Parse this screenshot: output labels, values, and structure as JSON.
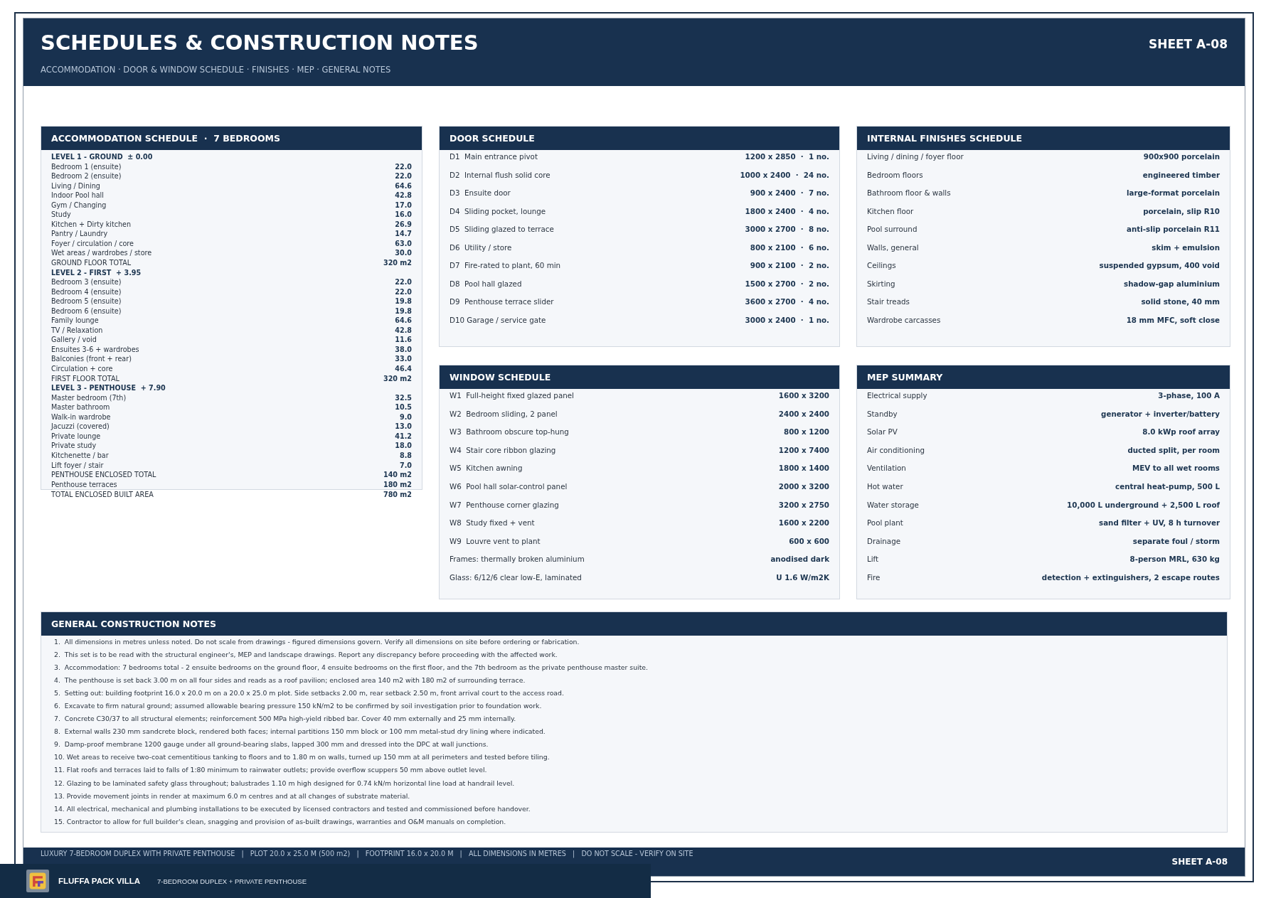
{
  "header": {
    "title": "SCHEDULES & CONSTRUCTION NOTES",
    "subtitle": "ACCOMMODATION · DOOR & WINDOW SCHEDULE · FINISHES · MEP · GENERAL NOTES",
    "sheet": "SHEET A-08"
  },
  "accommodation": {
    "title": "ACCOMMODATION SCHEDULE  ·  7 BEDROOMS",
    "rows": [
      {
        "kind": "level",
        "label": "LEVEL 1 - GROUND  ± 0.00"
      },
      {
        "kind": "room",
        "label": "Bedroom 1 (ensuite)",
        "area": "22.0"
      },
      {
        "kind": "room",
        "label": "Bedroom 2 (ensuite)",
        "area": "22.0"
      },
      {
        "kind": "room",
        "label": "Living / Dining",
        "area": "64.6"
      },
      {
        "kind": "room",
        "label": "Indoor Pool hall",
        "area": "42.8"
      },
      {
        "kind": "room",
        "label": "Gym / Changing",
        "area": "17.0"
      },
      {
        "kind": "room",
        "label": "Study",
        "area": "16.0"
      },
      {
        "kind": "room",
        "label": "Kitchen + Dirty kitchen",
        "area": "26.9"
      },
      {
        "kind": "room",
        "label": "Pantry / Laundry",
        "area": "14.7"
      },
      {
        "kind": "room",
        "label": "Foyer / circulation / core",
        "area": "63.0"
      },
      {
        "kind": "room",
        "label": "Wet areas / wardrobes / store",
        "area": "30.0"
      },
      {
        "kind": "total",
        "label": "GROUND FLOOR TOTAL",
        "area": "320 m2"
      },
      {
        "kind": "level",
        "label": "LEVEL 2 - FIRST  + 3.95"
      },
      {
        "kind": "room",
        "label": "Bedroom 3 (ensuite)",
        "area": "22.0"
      },
      {
        "kind": "room",
        "label": "Bedroom 4 (ensuite)",
        "area": "22.0"
      },
      {
        "kind": "room",
        "label": "Bedroom 5 (ensuite)",
        "area": "19.8"
      },
      {
        "kind": "room",
        "label": "Bedroom 6 (ensuite)",
        "area": "19.8"
      },
      {
        "kind": "room",
        "label": "Family lounge",
        "area": "64.6"
      },
      {
        "kind": "room",
        "label": "TV / Relaxation",
        "area": "42.8"
      },
      {
        "kind": "room",
        "label": "Gallery / void",
        "area": "11.6"
      },
      {
        "kind": "room",
        "label": "Ensuites 3-6 + wardrobes",
        "area": "38.0"
      },
      {
        "kind": "room",
        "label": "Balconies (front + rear)",
        "area": "33.0"
      },
      {
        "kind": "room",
        "label": "Circulation + core",
        "area": "46.4"
      },
      {
        "kind": "total",
        "label": "FIRST FLOOR TOTAL",
        "area": "320 m2"
      },
      {
        "kind": "level",
        "label": "LEVEL 3 - PENTHOUSE  + 7.90"
      },
      {
        "kind": "room",
        "label": "Master bedroom (7th)",
        "area": "32.5"
      },
      {
        "kind": "room",
        "label": "Master bathroom",
        "area": "10.5"
      },
      {
        "kind": "room",
        "label": "Walk-in wardrobe",
        "area": "9.0"
      },
      {
        "kind": "room",
        "label": "Jacuzzi (covered)",
        "area": "13.0"
      },
      {
        "kind": "room",
        "label": "Private lounge",
        "area": "41.2"
      },
      {
        "kind": "room",
        "label": "Private study",
        "area": "18.0"
      },
      {
        "kind": "room",
        "label": "Kitchenette / bar",
        "area": "8.8"
      },
      {
        "kind": "room",
        "label": "Lift foyer / stair",
        "area": "7.0"
      },
      {
        "kind": "total",
        "label": "PENTHOUSE ENCLOSED TOTAL",
        "area": "140 m2"
      },
      {
        "kind": "room",
        "label": "Penthouse terraces",
        "area": "180 m2"
      },
      {
        "kind": "total",
        "label": "TOTAL ENCLOSED BUILT AREA",
        "area": "780 m2"
      }
    ]
  },
  "doors": {
    "title": "DOOR SCHEDULE",
    "rows": [
      {
        "label": "D1  Main entrance pivot",
        "value": "1200 x 2850  ·  1 no."
      },
      {
        "label": "D2  Internal flush solid core",
        "value": "1000 x 2400  ·  24 no."
      },
      {
        "label": "D3  Ensuite door",
        "value": "900 x 2400  ·  7 no."
      },
      {
        "label": "D4  Sliding pocket, lounge",
        "value": "1800 x 2400  ·  4 no."
      },
      {
        "label": "D5  Sliding glazed to terrace",
        "value": "3000 x 2700  ·  8 no."
      },
      {
        "label": "D6  Utility / store",
        "value": "800 x 2100  ·  6 no."
      },
      {
        "label": "D7  Fire-rated to plant, 60 min",
        "value": "900 x 2100  ·  2 no."
      },
      {
        "label": "D8  Pool hall glazed",
        "value": "1500 x 2700  ·  2 no."
      },
      {
        "label": "D9  Penthouse terrace slider",
        "value": "3600 x 2700  ·  4 no."
      },
      {
        "label": "D10 Garage / service gate",
        "value": "3000 x 2400  ·  1 no."
      }
    ]
  },
  "finishes": {
    "title": "INTERNAL FINISHES SCHEDULE",
    "rows": [
      {
        "label": "Living / dining / foyer floor",
        "value": "900x900 porcelain"
      },
      {
        "label": "Bedroom floors",
        "value": "engineered timber"
      },
      {
        "label": "Bathroom floor & walls",
        "value": "large-format porcelain"
      },
      {
        "label": "Kitchen floor",
        "value": "porcelain, slip R10"
      },
      {
        "label": "Pool surround",
        "value": "anti-slip porcelain R11"
      },
      {
        "label": "Walls, general",
        "value": "skim + emulsion"
      },
      {
        "label": "Ceilings",
        "value": "suspended gypsum, 400 void"
      },
      {
        "label": "Skirting",
        "value": "shadow-gap aluminium"
      },
      {
        "label": "Stair treads",
        "value": "solid stone, 40 mm"
      },
      {
        "label": "Wardrobe carcasses",
        "value": "18 mm MFC, soft close"
      }
    ]
  },
  "windows": {
    "title": "WINDOW SCHEDULE",
    "rows": [
      {
        "label": "W1  Full-height fixed glazed panel",
        "value": "1600 x 3200"
      },
      {
        "label": "W2  Bedroom sliding, 2 panel",
        "value": "2400 x 2400"
      },
      {
        "label": "W3  Bathroom obscure top-hung",
        "value": "800 x 1200"
      },
      {
        "label": "W4  Stair core ribbon glazing",
        "value": "1200 x 7400"
      },
      {
        "label": "W5  Kitchen awning",
        "value": "1800 x 1400"
      },
      {
        "label": "W6  Pool hall solar-control panel",
        "value": "2000 x 3200"
      },
      {
        "label": "W7  Penthouse corner glazing",
        "value": "3200 x 2750"
      },
      {
        "label": "W8  Study fixed + vent",
        "value": "1600 x 2200"
      },
      {
        "label": "W9  Louvre vent to plant",
        "value": "600 x 600"
      },
      {
        "label": "Frames: thermally broken aluminium",
        "value": "anodised dark"
      },
      {
        "label": "Glass: 6/12/6 clear low-E, laminated",
        "value": "U 1.6 W/m2K"
      }
    ]
  },
  "mep": {
    "title": "MEP SUMMARY",
    "rows": [
      {
        "label": "Electrical supply",
        "value": "3-phase, 100 A"
      },
      {
        "label": "Standby",
        "value": "generator + inverter/battery"
      },
      {
        "label": "Solar PV",
        "value": "8.0 kWp roof array"
      },
      {
        "label": "Air conditioning",
        "value": "ducted split, per room"
      },
      {
        "label": "Ventilation",
        "value": "MEV to all wet rooms"
      },
      {
        "label": "Hot water",
        "value": "central heat-pump, 500 L"
      },
      {
        "label": "Water storage",
        "value": "10,000 L underground + 2,500 L roof"
      },
      {
        "label": "Pool plant",
        "value": "sand filter + UV, 8 h turnover"
      },
      {
        "label": "Drainage",
        "value": "separate foul / storm"
      },
      {
        "label": "Lift",
        "value": "8-person MRL, 630 kg"
      },
      {
        "label": "Fire",
        "value": "detection + extinguishers, 2 escape routes"
      }
    ]
  },
  "notes": {
    "title": "GENERAL CONSTRUCTION NOTES",
    "items": [
      "1.  All dimensions in metres unless noted. Do not scale from drawings - figured dimensions govern. Verify all dimensions on site before ordering or fabrication.",
      "2.  This set is to be read with the structural engineer's, MEP and landscape drawings. Report any discrepancy before proceeding with the affected work.",
      "3.  Accommodation: 7 bedrooms total - 2 ensuite bedrooms on the ground floor, 4 ensuite bedrooms on the first floor, and the 7th bedroom as the private penthouse master suite.",
      "4.  The penthouse is set back 3.00 m on all four sides and reads as a roof pavilion; enclosed area 140 m2 with 180 m2 of surrounding terrace.",
      "5.  Setting out: building footprint 16.0 x 20.0 m on a 20.0 x 25.0 m plot. Side setbacks 2.00 m, rear setback 2.50 m, front arrival court to the access road.",
      "6.  Excavate to firm natural ground; assumed allowable bearing pressure 150 kN/m2 to be confirmed by soil investigation prior to foundation work.",
      "7.  Concrete C30/37 to all structural elements; reinforcement 500 MPa high-yield ribbed bar. Cover 40 mm externally and 25 mm internally.",
      "8.  External walls 230 mm sandcrete block, rendered both faces; internal partitions 150 mm block or 100 mm metal-stud dry lining where indicated.",
      "9.  Damp-proof membrane 1200 gauge under all ground-bearing slabs, lapped 300 mm and dressed into the DPC at wall junctions.",
      "10. Wet areas to receive two-coat cementitious tanking to floors and to 1.80 m on walls, turned up 150 mm at all perimeters and tested before tiling.",
      "11. Flat roofs and terraces laid to falls of 1:80 minimum to rainwater outlets; provide overflow scuppers 50 mm above outlet level.",
      "12. Glazing to be laminated safety glass throughout; balustrades 1.10 m high designed for 0.74 kN/m horizontal line load at handrail level.",
      "13. Provide movement joints in render at maximum 6.0 m centres and at all changes of substrate material.",
      "14. All electrical, mechanical and plumbing installations to be executed by licensed contractors and tested and commissioned before handover.",
      "15. Contractor to allow for full builder's clean, snagging and provision of as-built drawings, warranties and O&M manuals on completion."
    ]
  },
  "footer": {
    "text": "LUXURY 7-BEDROOM DUPLEX WITH PRIVATE PENTHOUSE   |   PLOT 20.0 x 25.0 M (500 m2)   |   FOOTPRINT 16.0 x 20.0 M   |   ALL DIMENSIONS IN METRES   |   DO NOT SCALE - VERIFY ON SITE",
    "sheet": "SHEET A-08"
  },
  "banner": {
    "name": "FLUFFA PACK VILLA",
    "tagline": "7-BEDROOM DUPLEX + PRIVATE PENTHOUSE"
  }
}
